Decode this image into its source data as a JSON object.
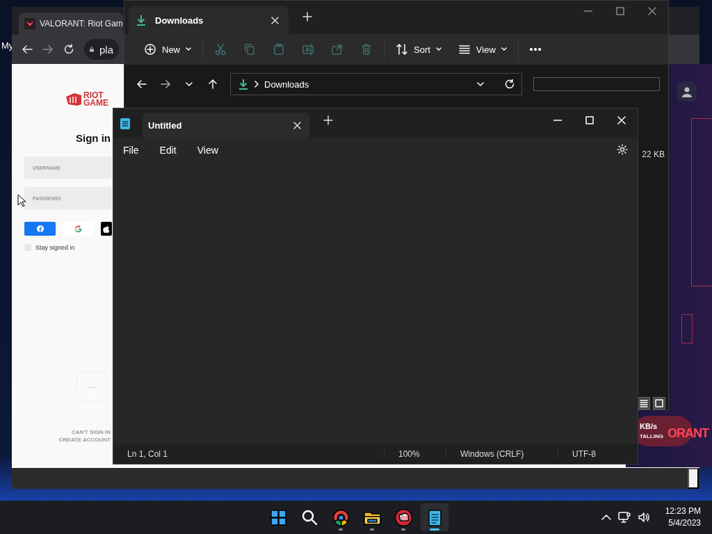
{
  "desktop": {
    "bookmark": "My"
  },
  "browser": {
    "tab_title": "VALORANT: Riot Gam",
    "address": "pla",
    "page": {
      "logo_line1": "RIOT",
      "logo_line2": "GAME",
      "heading": "Sign in",
      "fields": [
        {
          "placeholder": "USERNAME"
        },
        {
          "placeholder": "PASSWORD"
        }
      ],
      "social_buttons": [
        {
          "kind": "facebook"
        },
        {
          "kind": "google"
        },
        {
          "kind": "apple"
        }
      ],
      "stay_signed_in": {
        "label": "Stay signed in",
        "checked": false
      },
      "links": [
        "CAN'T SIGN IN",
        "CREATE ACCOUNT"
      ]
    }
  },
  "riot_client": {
    "speed": "KB/s",
    "status": "TALLING",
    "logo": "ORANT"
  },
  "explorer": {
    "tab": {
      "title": "Downloads"
    },
    "toolbar": [
      {
        "kind": "new",
        "label": "New",
        "disabled": false
      },
      {
        "kind": "cut",
        "disabled": true
      },
      {
        "kind": "copy",
        "disabled": true
      },
      {
        "kind": "paste",
        "disabled": true
      },
      {
        "kind": "rename",
        "disabled": true
      },
      {
        "kind": "share",
        "disabled": true
      },
      {
        "kind": "delete",
        "disabled": true
      },
      {
        "kind": "sort",
        "label": "Sort",
        "disabled": false
      },
      {
        "kind": "view",
        "label": "View",
        "disabled": false
      },
      {
        "kind": "more",
        "disabled": false
      }
    ],
    "address": "Downloads",
    "file_size": "22 KB"
  },
  "notepad": {
    "tab": {
      "title": "Untitled"
    },
    "menu": [
      "File",
      "Edit",
      "View"
    ],
    "status_bar": [
      "Ln 1, Col 1",
      "100%",
      "Windows (CRLF)",
      "UTF-8"
    ]
  },
  "taskbar": {
    "apps": [
      {
        "kind": "start",
        "running": false,
        "selected": false
      },
      {
        "kind": "search",
        "running": false,
        "selected": false
      },
      {
        "kind": "chrome",
        "running": true,
        "selected": false
      },
      {
        "kind": "explorer",
        "running": true,
        "selected": false
      },
      {
        "kind": "riot",
        "running": true,
        "selected": false
      },
      {
        "kind": "notepad",
        "running": true,
        "selected": true
      }
    ],
    "time": "12:23 PM",
    "date": "5/4/2023"
  }
}
